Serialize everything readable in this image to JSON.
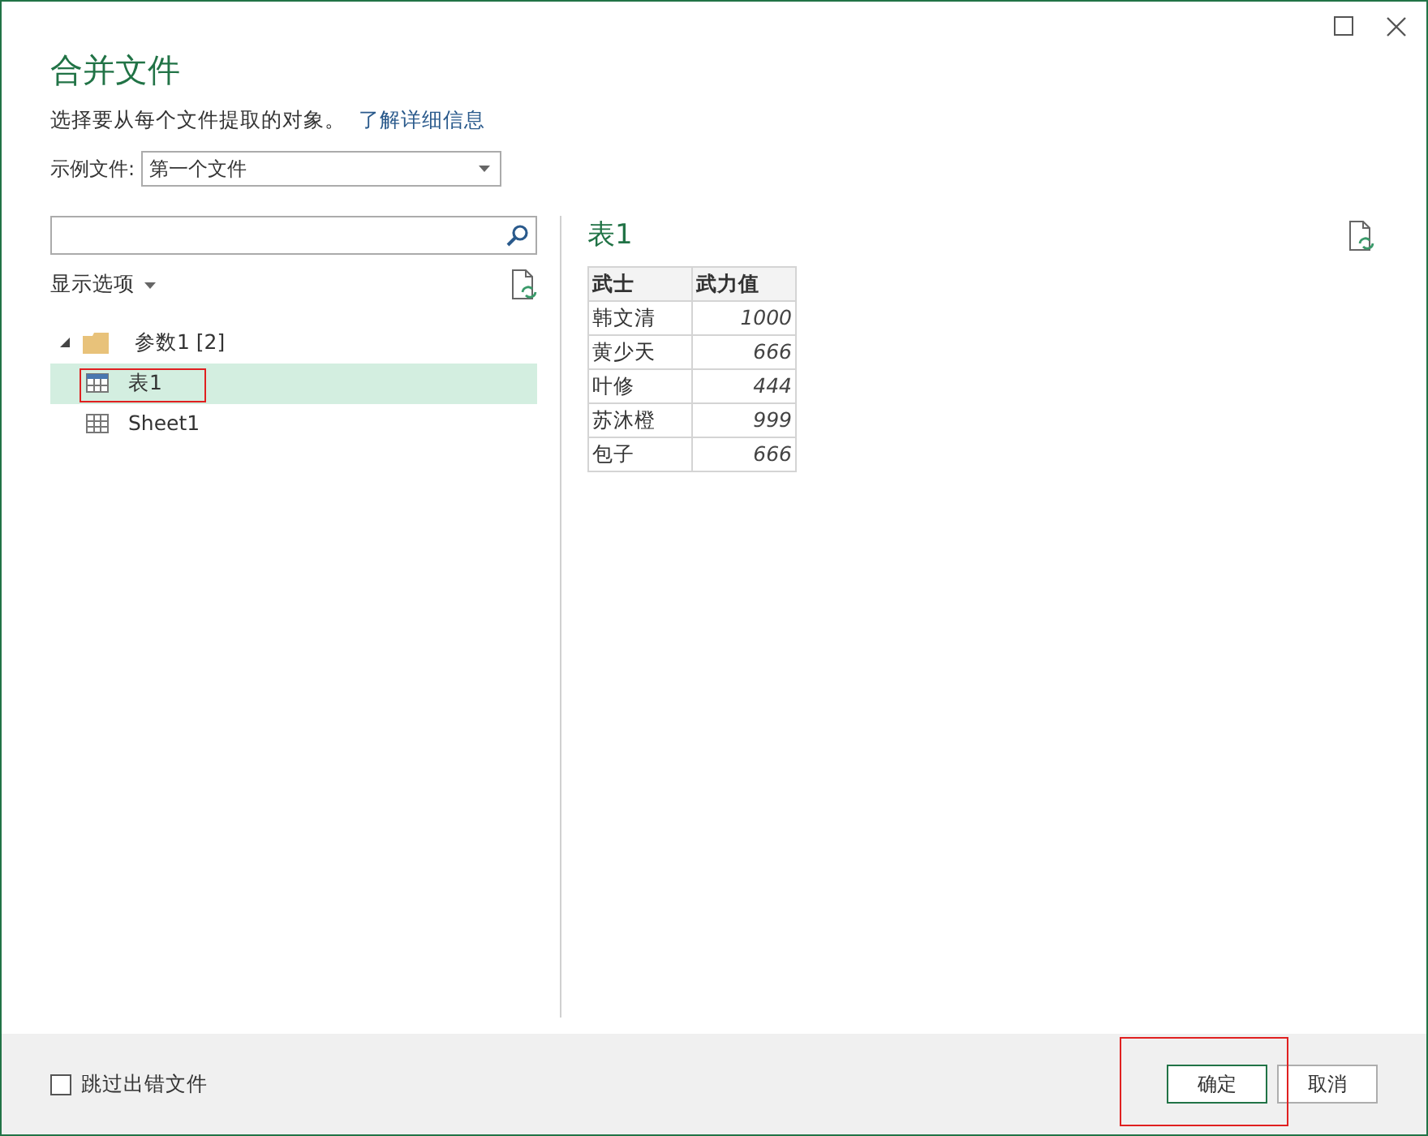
{
  "window": {
    "title": "合并文件"
  },
  "description": "选择要从每个文件提取的对象。",
  "learn_more_link": "了解详细信息",
  "example_file": {
    "label": "示例文件:",
    "value": "第一个文件"
  },
  "navigator": {
    "display_options": "显示选项",
    "tree": [
      {
        "label": "参数1 [2]",
        "kind": "folder",
        "expanded": true,
        "selected": false,
        "children": [
          {
            "label": "表1",
            "kind": "table",
            "selected": true
          },
          {
            "label": "Sheet1",
            "kind": "sheet",
            "selected": false
          }
        ]
      }
    ]
  },
  "preview": {
    "title": "表1",
    "table": {
      "columns": [
        "武士",
        "武力值"
      ],
      "rows": [
        [
          "韩文清",
          "1000"
        ],
        [
          "黄少天",
          "666"
        ],
        [
          "叶修",
          "444"
        ],
        [
          "苏沐橙",
          "999"
        ],
        [
          "包子",
          "666"
        ]
      ]
    }
  },
  "skip_errors": {
    "label": "跳过出错文件",
    "checked": false
  },
  "buttons": [
    {
      "label": "确定",
      "primary": true
    },
    {
      "label": "取消",
      "primary": false
    }
  ]
}
